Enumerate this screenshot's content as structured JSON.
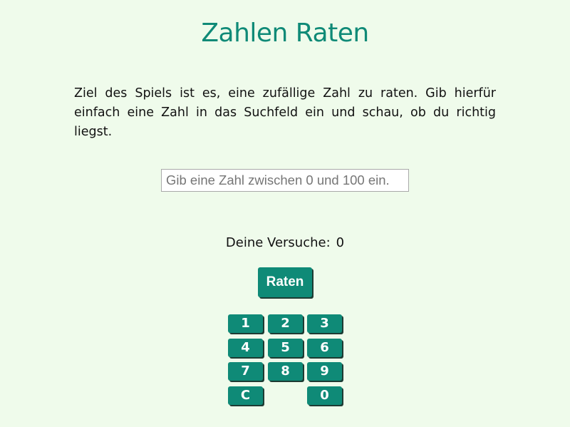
{
  "title": "Zahlen Raten",
  "intro": "Ziel des Spiels ist es, eine zufällige Zahl zu raten. Gib hierfür einfach eine Zahl in das Suchfeld ein und schau, ob du richtig liegst.",
  "guess_input": {
    "value": "",
    "placeholder": "Gib eine Zahl zwischen 0 und 100 ein."
  },
  "attempts": {
    "label": "Deine Versuche:",
    "count": "0"
  },
  "guess_button": {
    "label": "Raten"
  },
  "keypad": {
    "keys": [
      "1",
      "2",
      "3",
      "4",
      "5",
      "6",
      "7",
      "8",
      "9",
      "C",
      "0"
    ]
  },
  "colors": {
    "background": "#effbeb",
    "accent": "#0f8a77",
    "button_shadow": "#1d3b33"
  }
}
